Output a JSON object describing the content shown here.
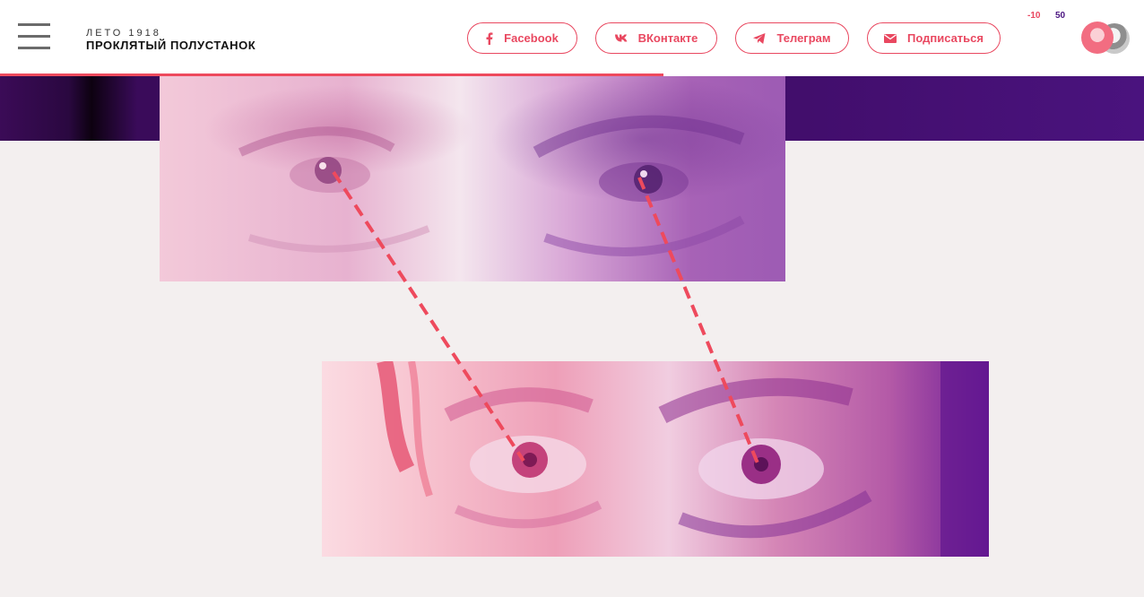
{
  "header": {
    "brand_top": "ЛЕТО 1918",
    "brand_main": "ПРОКЛЯТЫЙ ПОЛУСТАНОК",
    "social": {
      "facebook": "Facebook",
      "vk": "ВКонтакте",
      "telegram": "Телеграм",
      "subscribe": "Подписаться"
    },
    "counter_left": "-10",
    "counter_right": "50"
  },
  "reading_progress": 0.58,
  "colors": {
    "accent": "#e94860",
    "purple": "#4a1480",
    "background": "#f3efef"
  },
  "icons": {
    "menu": "hamburger-icon",
    "facebook": "facebook-icon",
    "vk": "vk-icon",
    "telegram": "telegram-icon",
    "subscribe": "mail-icon"
  }
}
